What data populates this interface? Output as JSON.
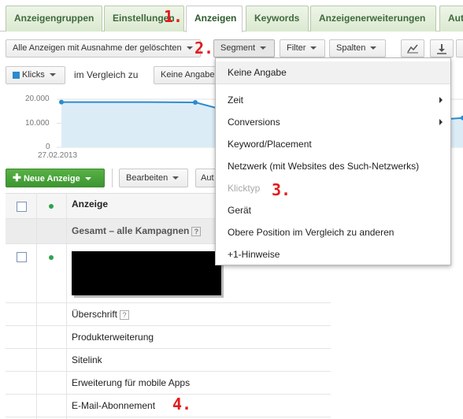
{
  "tabs": [
    {
      "label": "Anzeigengruppen"
    },
    {
      "label": "Einstellungen"
    },
    {
      "label": "Anzeigen",
      "active": true
    },
    {
      "label": "Keywords"
    },
    {
      "label": "Anzeigenerweiterungen"
    },
    {
      "label": "Aut"
    }
  ],
  "toolbar": {
    "filter_dropdown": "Alle Anzeigen mit Ausnahme der gelöschten",
    "segment": "Segment",
    "filter": "Filter",
    "columns": "Spalten",
    "chart_icon": "line-chart-icon",
    "download_icon": "download-icon"
  },
  "chart_controls": {
    "metric": "Klicks",
    "metric_color": "#2b8ccf",
    "compare_label": "im Vergleich zu",
    "compare_value": "Keine Angabe"
  },
  "chart_data": {
    "type": "area",
    "yticks": [
      "20.000",
      "10.000",
      "0"
    ],
    "ylim": [
      0,
      20000
    ],
    "x_start_label": "27.02.2013",
    "series": [
      {
        "values": [
          18800,
          18800,
          18800,
          18700,
          13800,
          10100,
          10100,
          10000,
          11000,
          12200
        ]
      }
    ]
  },
  "actions": {
    "new_ad": "Neue Anzeige",
    "edit": "Bearbeiten",
    "more": "Aut"
  },
  "table": {
    "header": "Anzeige",
    "total_label": "Gesamt – alle Kampagnen",
    "rows": [
      "Überschrift",
      "Produkterweiterung",
      "Sitelink",
      "Erweiterung für mobile Apps",
      "E-Mail-Abonnement"
    ]
  },
  "dropdown": {
    "items": [
      {
        "label": "Keine Angabe"
      },
      {
        "label": "Zeit",
        "submenu": true
      },
      {
        "label": "Conversions",
        "submenu": true
      },
      {
        "label": "Keyword/Placement"
      },
      {
        "label": "Netzwerk (mit Websites des Such-Netzwerks)"
      },
      {
        "label": "Klicktyp",
        "disabled": true
      },
      {
        "label": "Gerät"
      },
      {
        "label": "Obere Position im Vergleich zu anderen"
      },
      {
        "label": "+1-Hinweise"
      }
    ]
  },
  "annotations": [
    "1.",
    "2.",
    "3.",
    "4."
  ],
  "colors": {
    "accent_green": "#3c9531",
    "tab_text": "#3d6a3d",
    "annotation": "#e31b1b",
    "line": "#2b8ccf"
  }
}
